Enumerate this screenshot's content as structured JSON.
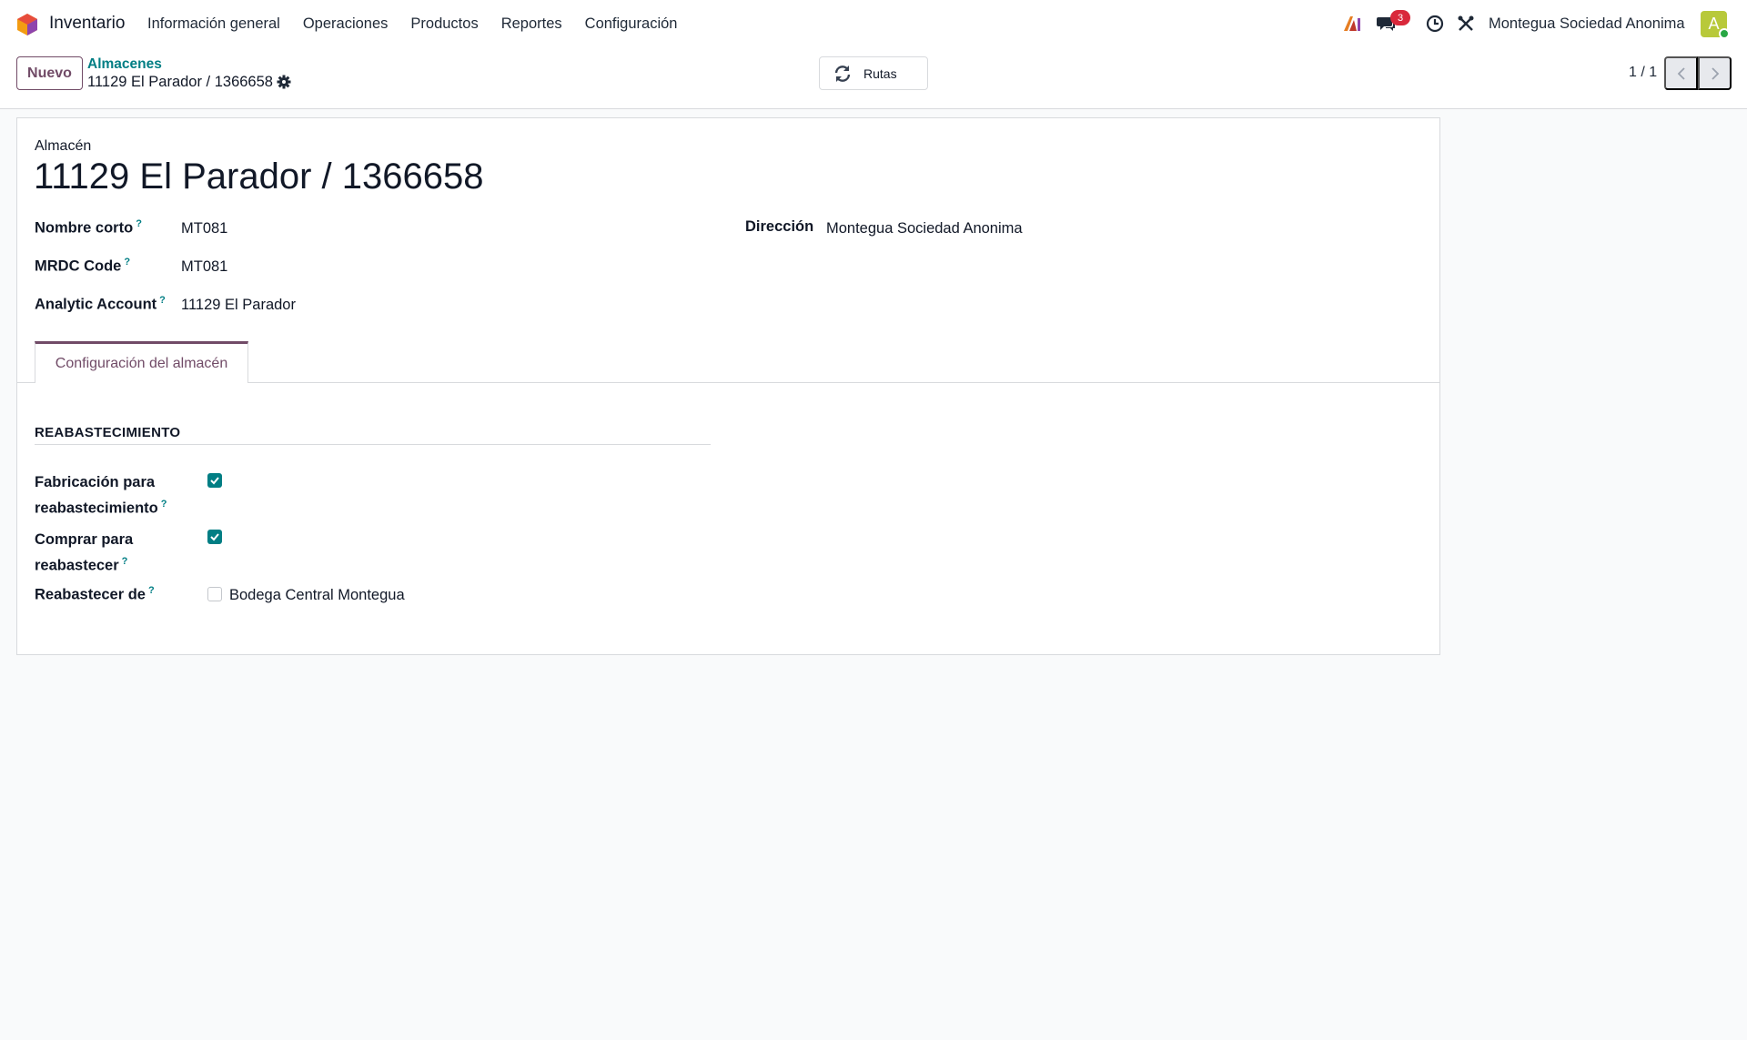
{
  "navbar": {
    "app_name": "Inventario",
    "menu": [
      "Información general",
      "Operaciones",
      "Productos",
      "Reportes",
      "Configuración"
    ],
    "messages_count": "3",
    "company": "Montegua Sociedad Anonima",
    "avatar_letter": "A",
    "colors": {
      "brand": "#714b67",
      "badge": "#d9283b",
      "avatar": "#b8c93a"
    }
  },
  "control": {
    "new_label": "Nuevo",
    "breadcrumb_parent": "Almacenes",
    "breadcrumb_current": "11129 El Parador / 1366658",
    "rutas_label": "Rutas",
    "pager": "1 / 1"
  },
  "form": {
    "record_label": "Almacén",
    "title": "11129 El Parador / 1366658",
    "fields": {
      "short_name": {
        "label": "Nombre corto",
        "help": "?",
        "value": "MT081"
      },
      "mrdc_code": {
        "label": "MRDC Code",
        "help": "?",
        "value": "MT081"
      },
      "analytic_account": {
        "label": "Analytic Account",
        "help": "?",
        "value": "11129 El Parador"
      },
      "address": {
        "label": "Dirección",
        "value": "Montegua Sociedad Anonima"
      }
    },
    "tab_label": "Configuración del almacén",
    "section_title": "REABASTECIMIENTO",
    "replenish": {
      "manufacture": {
        "label_line1": "Fabricación para",
        "label_line2": "reabastecimiento",
        "help": "?",
        "checked": true
      },
      "buy": {
        "label_line1": "Comprar para",
        "label_line2": "reabastecer",
        "help": "?",
        "checked": true
      },
      "resupply_from": {
        "label": "Reabastecer de",
        "help": "?",
        "option": "Bodega Central Montegua",
        "checked": false
      }
    }
  }
}
